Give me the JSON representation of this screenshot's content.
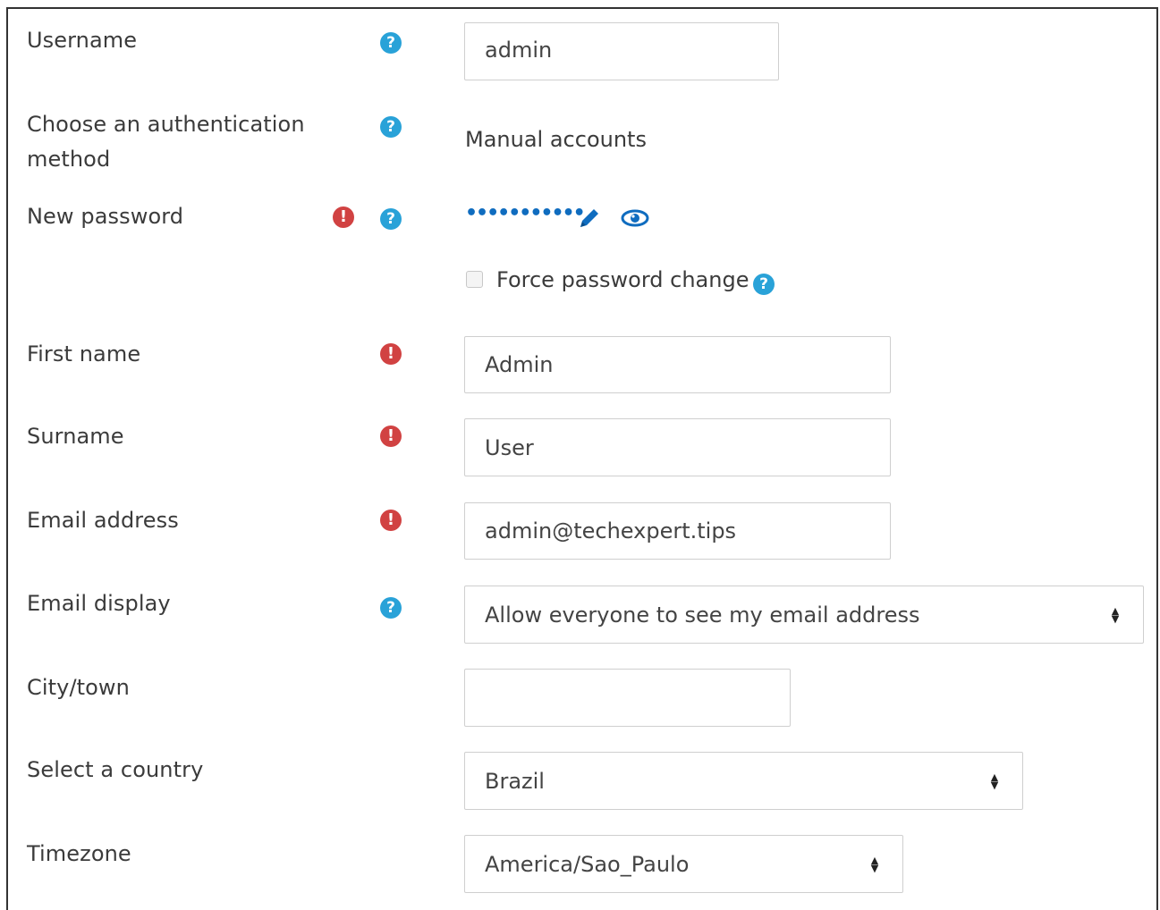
{
  "fields": {
    "username": {
      "label": "Username",
      "value": "admin"
    },
    "auth": {
      "label_line1": "Choose an authentication",
      "label_line2": "method",
      "value": "Manual accounts"
    },
    "password": {
      "label": "New password",
      "value": "•••••••••••"
    },
    "force": {
      "label": "Force password change"
    },
    "firstname": {
      "label": "First name",
      "value": "Admin"
    },
    "surname": {
      "label": "Surname",
      "value": "User"
    },
    "email": {
      "label": "Email address",
      "value": "admin@techexpert.tips"
    },
    "emaildisplay": {
      "label": "Email display",
      "value": "Allow everyone to see my email address"
    },
    "city": {
      "label": "City/town",
      "value": ""
    },
    "country": {
      "label": "Select a country",
      "value": "Brazil"
    },
    "timezone": {
      "label": "Timezone",
      "value": "America/Sao_Paulo"
    }
  },
  "icons": {
    "help": "?",
    "required": "!"
  },
  "colors": {
    "help": "#29a2d8",
    "required": "#d14242",
    "link": "#0f6cbf"
  }
}
